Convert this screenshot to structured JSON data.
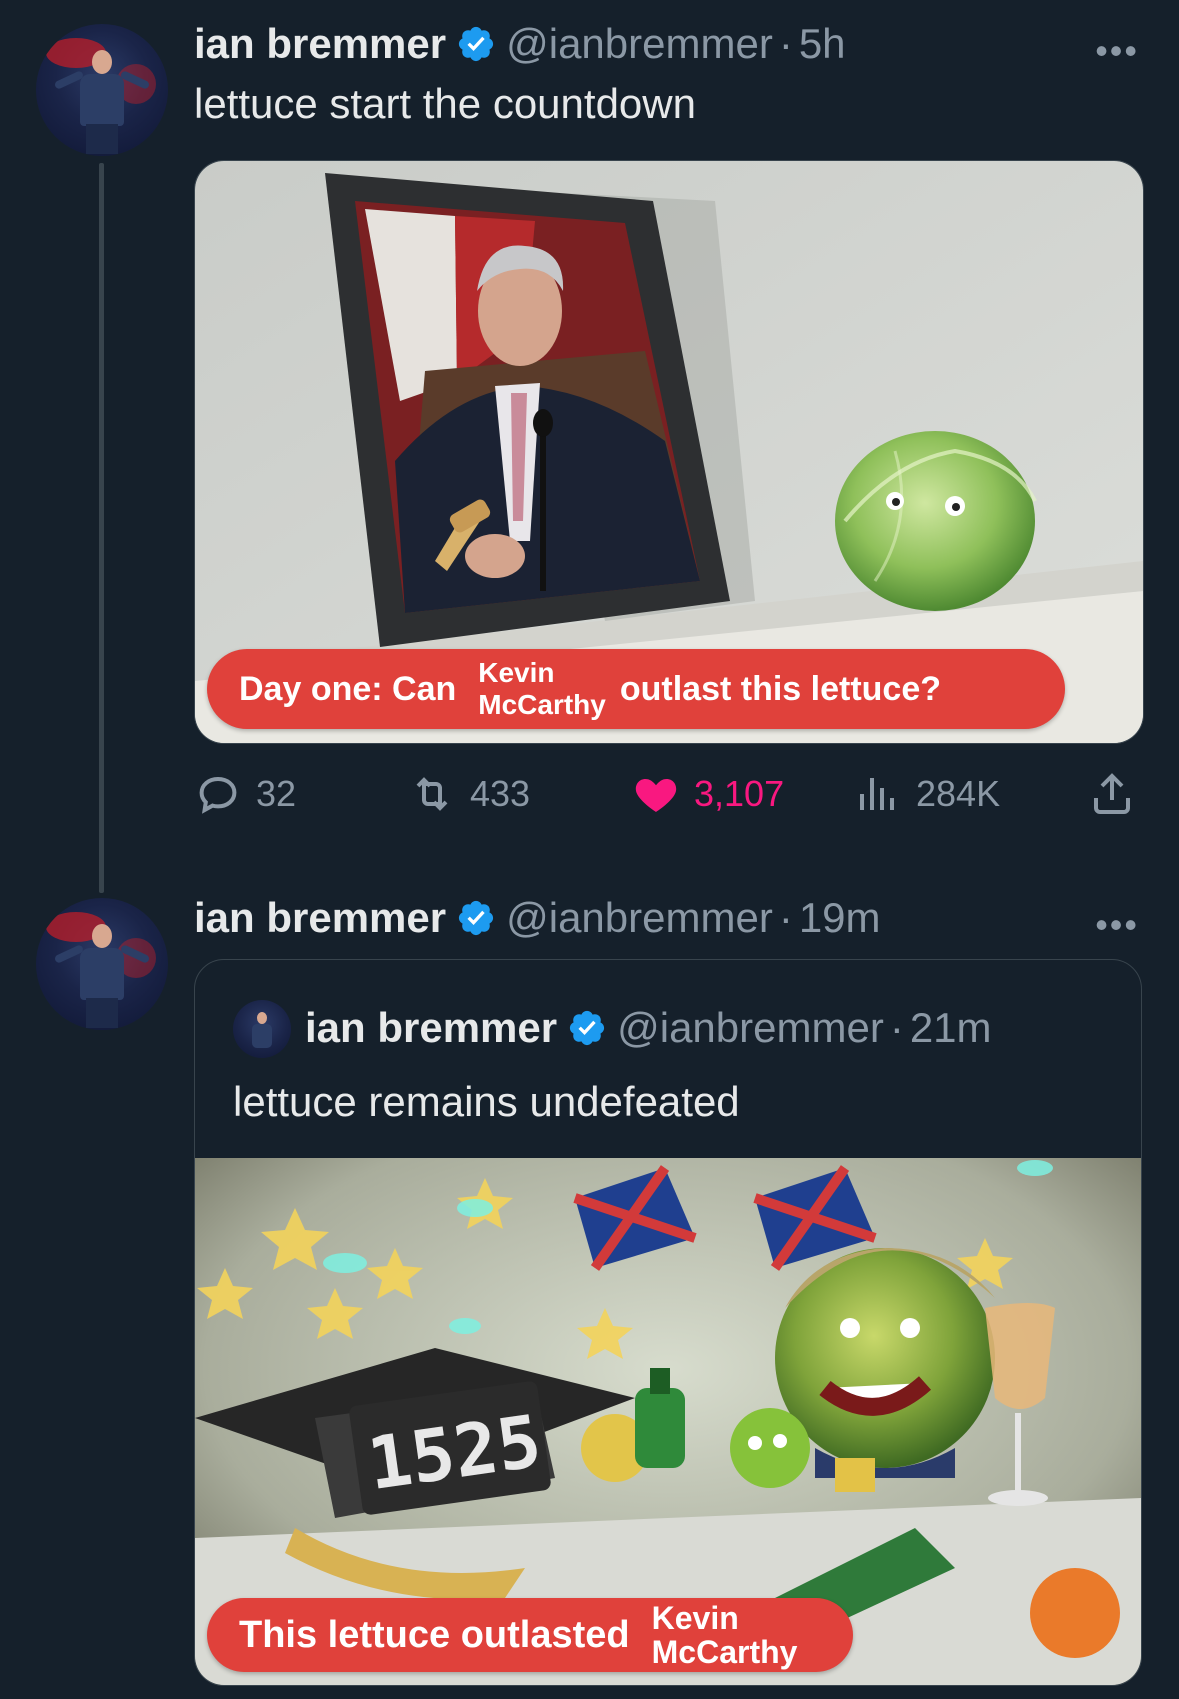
{
  "tweet1": {
    "name": "ian bremmer",
    "handle": "@ianbremmer",
    "separator": "·",
    "time": "5h",
    "text": "lettuce start the countdown",
    "more": "•••",
    "image": {
      "banner_prefix": "Day one: Can",
      "banner_name_line1": "Kevin",
      "banner_name_line2": "McCarthy",
      "banner_suffix": "outlast this lettuce?"
    },
    "actions": {
      "replies": "32",
      "retweets": "433",
      "likes": "3,107",
      "views": "284K"
    }
  },
  "tweet2": {
    "name": "ian bremmer",
    "handle": "@ianbremmer",
    "separator": "·",
    "time": "19m",
    "more": "•••",
    "quote": {
      "name": "ian bremmer",
      "handle": "@ianbremmer",
      "separator": "·",
      "time": "21m",
      "text": "lettuce remains undefeated",
      "image": {
        "clock": "1525",
        "banner_prefix": "This lettuce outlasted",
        "banner_name_line1": "Kevin",
        "banner_name_line2": "McCarthy"
      }
    }
  },
  "colors": {
    "background": "#15202b",
    "text": "#e7e9ea",
    "muted": "#8b98a5",
    "verified": "#1d9bf0",
    "like": "#f91880",
    "banner": "#e0413b"
  },
  "icons": [
    "verified-badge-icon",
    "reply-icon",
    "retweet-icon",
    "heart-icon",
    "views-icon",
    "share-icon",
    "more-icon"
  ]
}
